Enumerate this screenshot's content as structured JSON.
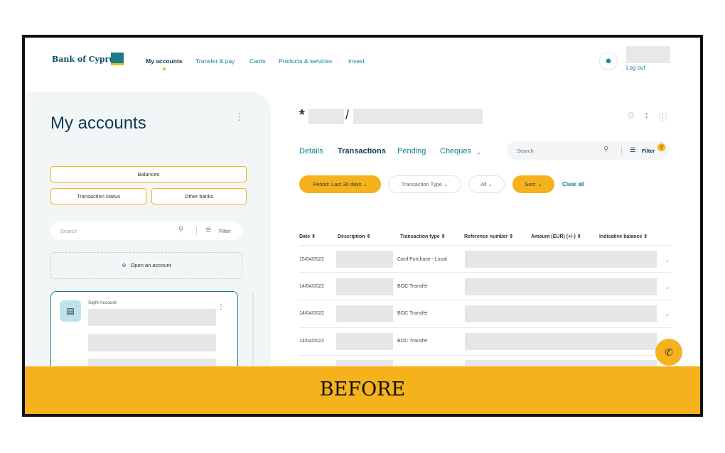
{
  "header": {
    "brand": "Bank of Cyprus",
    "nav": [
      "My accounts",
      "Transfer & pay",
      "Cards",
      "Products & services",
      "Invest"
    ],
    "logout": "Log out"
  },
  "sidebar": {
    "title": "My accounts",
    "chips": {
      "balances": "Balances",
      "transaction_status": "Transaction status",
      "other_banks": "Other banks"
    },
    "search_placeholder": "Search",
    "filter_label": "Filter",
    "open_account": "Open an account",
    "account_card": {
      "title": "Sight Account"
    }
  },
  "main": {
    "account_prefix": "*",
    "tabs": [
      "Details",
      "Transactions",
      "Pending",
      "Cheques"
    ],
    "search_placeholder": "Search",
    "filter_label": "Filter",
    "filter_count": "2",
    "filters": {
      "period": "Period: Last 30 days",
      "transaction_type": "Transaction Type",
      "all": "All",
      "sort": "Sort:",
      "clear_all": "Clear all"
    },
    "columns": [
      "Date",
      "Description",
      "Transaction type",
      "Reference number",
      "Amount (EUR) (+/-)",
      "Indicative balance"
    ],
    "rows": [
      {
        "date": "15/04/2022",
        "type": "Card Purchase - Local"
      },
      {
        "date": "14/04/2022",
        "type": "BOC Transfer"
      },
      {
        "date": "14/04/2022",
        "type": "BOC Transfer"
      },
      {
        "date": "14/04/2022",
        "type": "BOC Transfer"
      }
    ]
  },
  "banner": {
    "text": "BEFORE"
  },
  "colors": {
    "accent": "#f5b21c",
    "teal": "#0e7f93",
    "navy": "#0b3a5a"
  }
}
